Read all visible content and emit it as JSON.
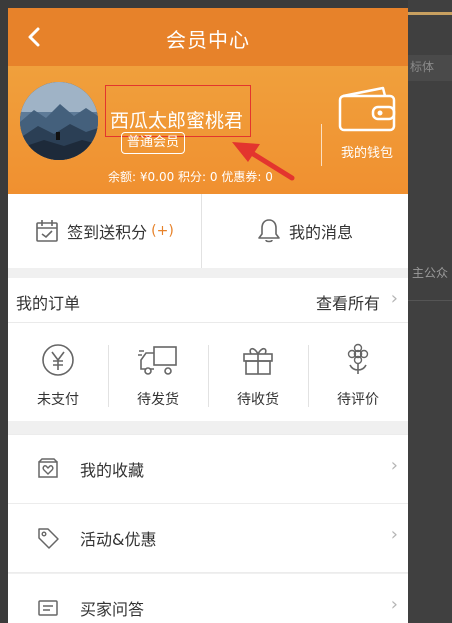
{
  "header": {
    "title": "会员中心"
  },
  "profile": {
    "name": "西瓜太郎蜜桃君",
    "level": "普通会员",
    "stats": "余额: ¥0.00 积分: 0 优惠券: 0",
    "wallet_label": "我的钱包"
  },
  "quick": {
    "checkin_label": "签到送积分",
    "checkin_plus": "(+)",
    "messages_label": "我的消息"
  },
  "orders": {
    "title": "我的订单",
    "more": "查看所有",
    "items": [
      {
        "label": "未支付",
        "icon": "yen-icon"
      },
      {
        "label": "待发货",
        "icon": "truck-icon"
      },
      {
        "label": "待收货",
        "icon": "gift-icon"
      },
      {
        "label": "待评价",
        "icon": "flower-icon"
      }
    ]
  },
  "menu": [
    {
      "label": "我的收藏",
      "icon": "favorites-icon"
    },
    {
      "label": "活动&优惠",
      "icon": "tag-icon"
    },
    {
      "label": "买家问答",
      "icon": "qa-icon"
    }
  ],
  "background": {
    "text1": "标体",
    "text2": "主公众"
  },
  "colors": {
    "accent": "#e7822a",
    "annotation": "#e3352e"
  }
}
